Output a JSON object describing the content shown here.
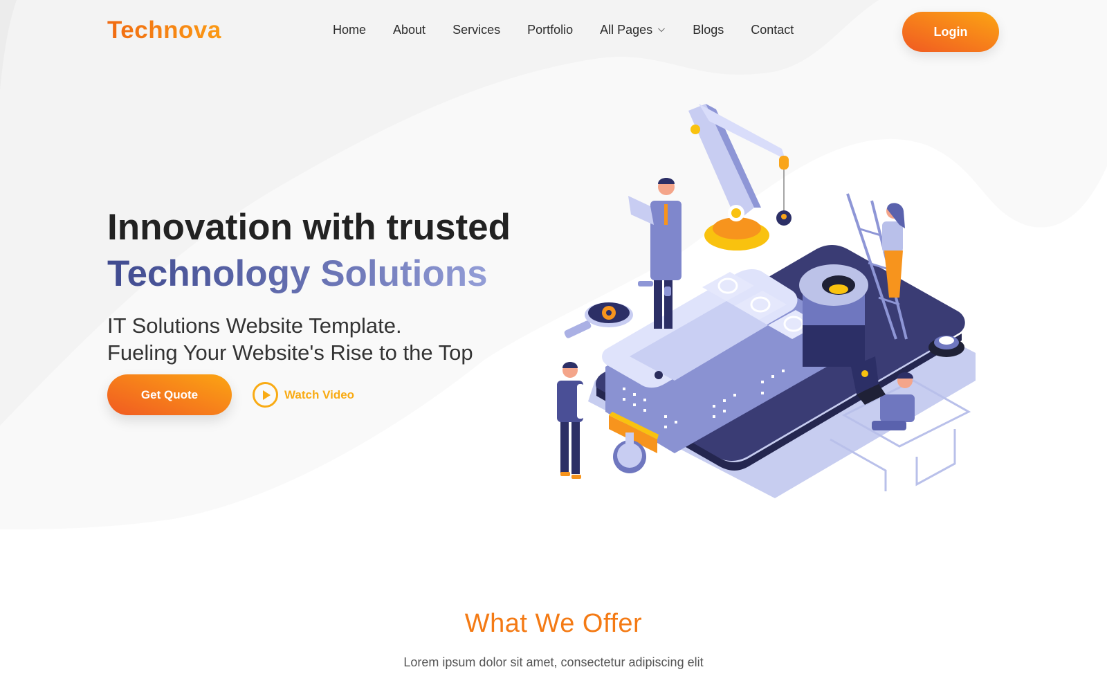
{
  "brand": {
    "name": "Technova",
    "accent": "#f47a14",
    "secondary": "#5a64a8"
  },
  "nav": {
    "items": [
      {
        "label": "Home"
      },
      {
        "label": "About"
      },
      {
        "label": "Services"
      },
      {
        "label": "Portfolio"
      },
      {
        "label": "All Pages",
        "has_dropdown": true,
        "icon": "chevron-down-icon"
      },
      {
        "label": "Blogs"
      },
      {
        "label": "Contact"
      }
    ],
    "login_label": "Login"
  },
  "hero": {
    "title_line1": "Innovation with trusted",
    "title_line2": "Technology Solutions",
    "subtitle_line1": "IT Solutions Website Template.",
    "subtitle_line2": "Fueling Your Website's Rise to the Top",
    "cta_primary": "Get Quote",
    "cta_secondary": "Watch Video",
    "cta_secondary_icon": "play-icon",
    "illustration": "isometric-tech-workers-phone-illustration"
  },
  "offer": {
    "heading": "What We Offer",
    "text": "Lorem ipsum dolor sit amet, consectetur adipiscing elit"
  }
}
